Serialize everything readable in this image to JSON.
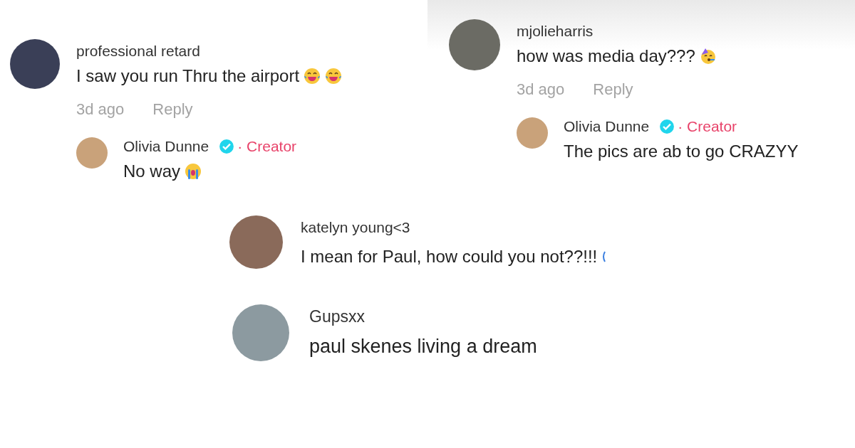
{
  "snippets": [
    {
      "comment": {
        "username": "professional retard",
        "text": "I saw you run Thru the airport",
        "emojis": [
          {
            "kind": "laughing"
          },
          {
            "kind": "laughing"
          }
        ],
        "time": "3d ago",
        "reply_label": "Reply"
      },
      "reply": {
        "username": "Olivia Dunne",
        "verified": true,
        "badge": "· Creator",
        "text": "No way",
        "emojis": [
          {
            "kind": "crying"
          }
        ]
      }
    },
    {
      "comment": {
        "username": "mjolieharris",
        "text": "how was media day???",
        "emojis": [
          {
            "kind": "party"
          }
        ],
        "time": "3d ago",
        "reply_label": "Reply"
      },
      "reply": {
        "username": "Olivia Dunne",
        "verified": true,
        "badge": "· Creator",
        "text": "The pics are ab to go CRAZYY"
      }
    },
    {
      "comment": {
        "username": "katelyn young<3",
        "text": "I mean for Paul, how could you not??!!!",
        "emojis": [
          {
            "kind": "cut"
          }
        ]
      }
    },
    {
      "comment": {
        "username": "Gupsxx",
        "text": "paul skenes living a dream"
      }
    }
  ]
}
